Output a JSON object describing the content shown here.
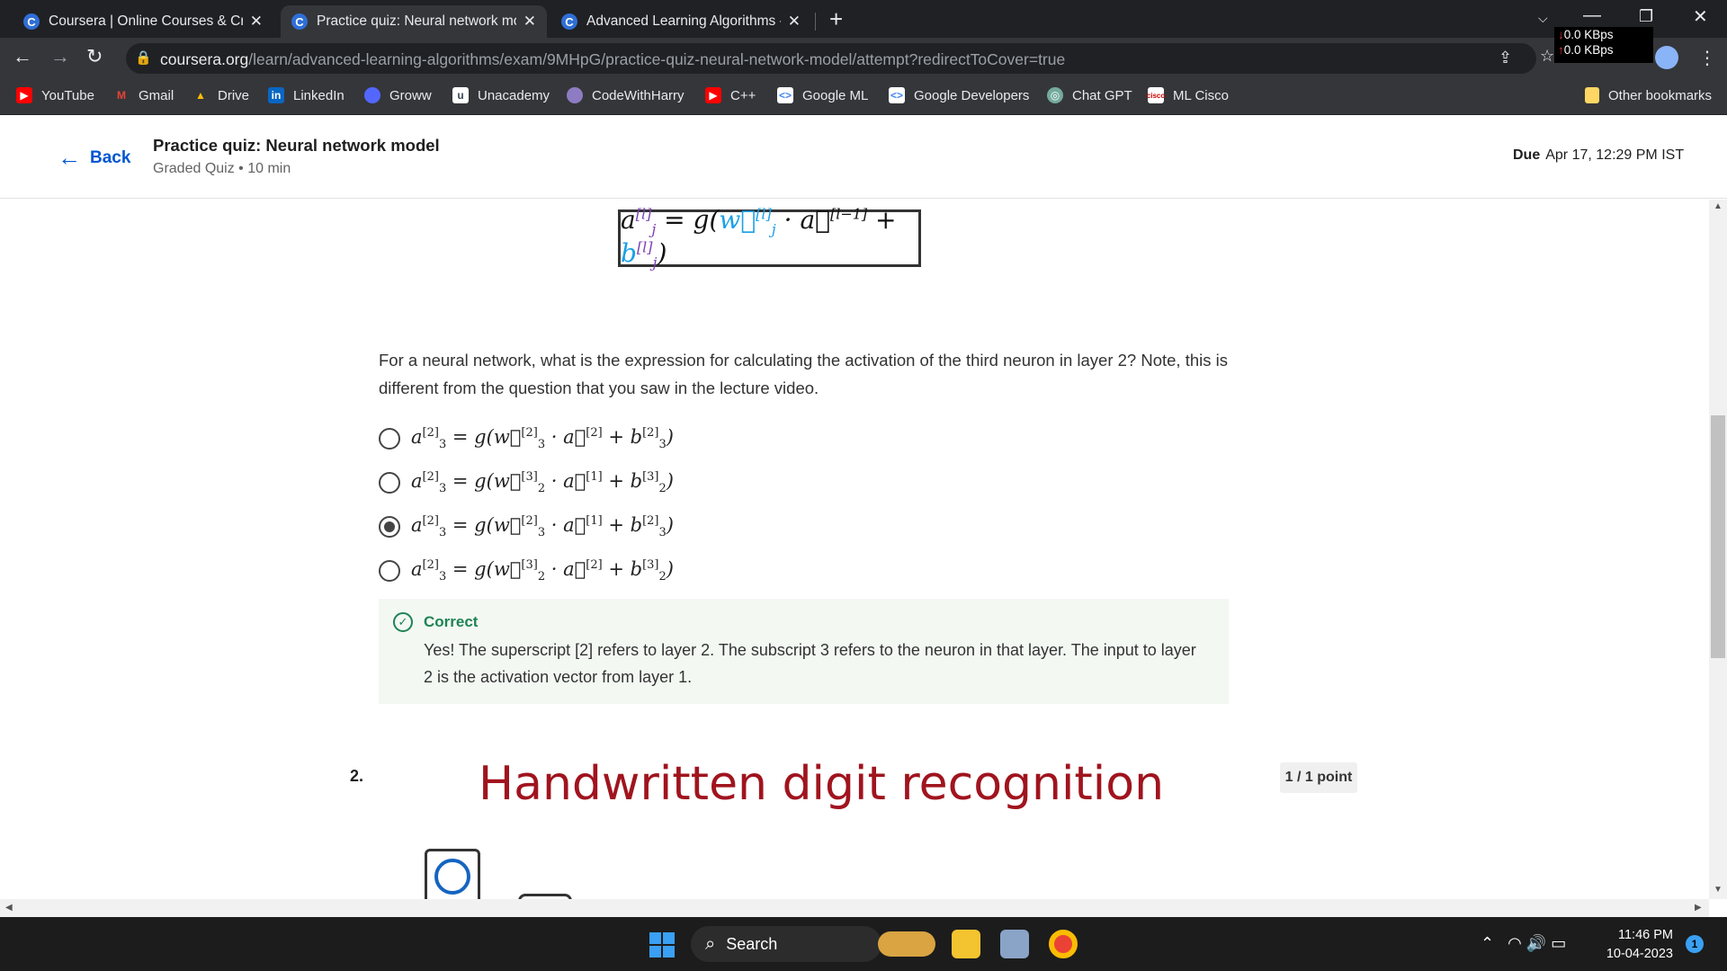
{
  "browser": {
    "tabs": [
      {
        "title": "Coursera | Online Courses & Credentials",
        "active": false
      },
      {
        "title": "Practice quiz: Neural network model",
        "active": true
      },
      {
        "title": "Advanced Learning Algorithms - ",
        "active": false
      }
    ],
    "url_host": "coursera.org",
    "url_path": "/learn/advanced-learning-algorithms/exam/9MHpG/practice-quiz-neural-network-model/attempt?redirectToCover=true",
    "net_down": "0.0 KBps",
    "net_up": "0.0 KBps",
    "bookmarks": [
      {
        "label": "YouTube",
        "icon": "youtube-icon",
        "color": "#ff0000"
      },
      {
        "label": "Gmail",
        "icon": "gmail-icon",
        "color": "#ea4335"
      },
      {
        "label": "Drive",
        "icon": "drive-icon",
        "color": "#34a853"
      },
      {
        "label": "LinkedIn",
        "icon": "linkedin-icon",
        "color": "#0a66c2"
      },
      {
        "label": "Groww",
        "icon": "groww-icon",
        "color": "#5367ff"
      },
      {
        "label": "Unacademy",
        "icon": "unacademy-icon",
        "color": "#3c4852"
      },
      {
        "label": "CodeWithHarry",
        "icon": "codewithharry-icon",
        "color": "#8e7cc3"
      },
      {
        "label": "C++",
        "icon": "youtube-icon",
        "color": "#ff0000"
      },
      {
        "label": "Google ML",
        "icon": "google-developers-icon",
        "color": "#4285f4"
      },
      {
        "label": "Google Developers",
        "icon": "google-developers-icon",
        "color": "#4285f4"
      },
      {
        "label": "Chat GPT",
        "icon": "chatgpt-icon",
        "color": "#74aa9c"
      },
      {
        "label": "ML Cisco",
        "icon": "cisco-icon",
        "color": "#cc0000"
      }
    ],
    "other_bookmarks": "Other bookmarks"
  },
  "header": {
    "back_label": "Back",
    "quiz_title": "Practice quiz: Neural network model",
    "quiz_subtitle": "Graded Quiz • 10 min",
    "due_label": "Due",
    "due_value": "Apr 17, 12:29 PM IST"
  },
  "question1": {
    "text": "For a neural network, what is the expression for calculating the activation of the third neuron in layer 2? Note, this is different from the question that you saw in the lecture video.",
    "options": [
      {
        "a_sup": "[2]",
        "a_sub": "3",
        "w_sup": "[2]",
        "w_sub": "3",
        "act_sup": "[2]",
        "b_sup": "[2]",
        "b_sub": "3",
        "selected": false
      },
      {
        "a_sup": "[2]",
        "a_sub": "3",
        "w_sup": "[3]",
        "w_sub": "2",
        "act_sup": "[1]",
        "b_sup": "[3]",
        "b_sub": "2",
        "selected": false
      },
      {
        "a_sup": "[2]",
        "a_sub": "3",
        "w_sup": "[2]",
        "w_sub": "3",
        "act_sup": "[1]",
        "b_sup": "[2]",
        "b_sub": "3",
        "selected": true
      },
      {
        "a_sup": "[2]",
        "a_sub": "3",
        "w_sup": "[3]",
        "w_sub": "2",
        "act_sup": "[2]",
        "b_sup": "[3]",
        "b_sub": "2",
        "selected": false
      }
    ],
    "feedback_title": "Correct",
    "feedback_text": "Yes! The superscript [2] refers to layer 2. The subscript 3 refers to the neuron in that layer. The input to layer 2 is the activation vector from layer 1."
  },
  "question2": {
    "number": "2.",
    "title": "Handwritten digit recognition",
    "points": "1 / 1 point"
  },
  "taskbar": {
    "search_label": "Search",
    "time": "11:46 PM",
    "date": "10-04-2023",
    "notifications": "1"
  }
}
